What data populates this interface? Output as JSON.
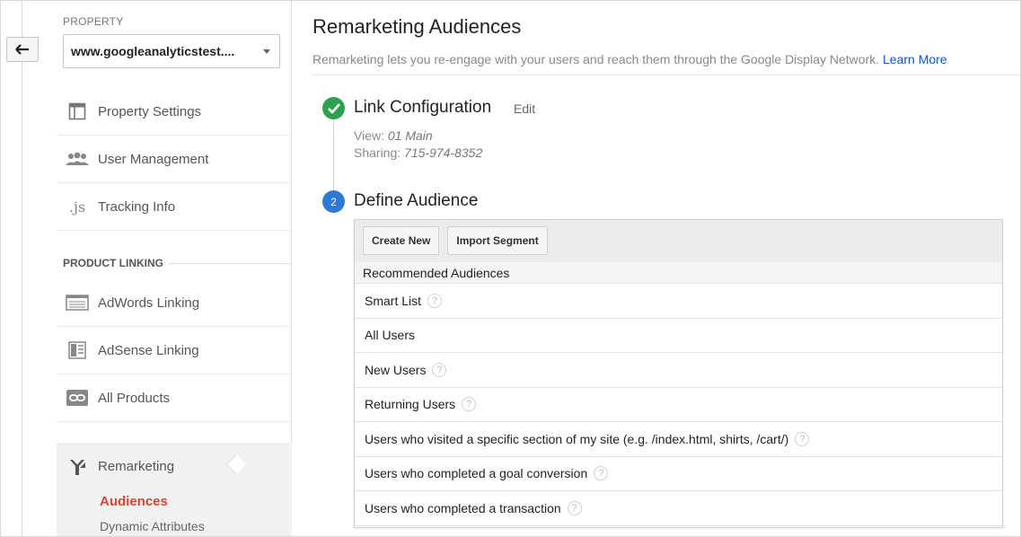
{
  "sidebar": {
    "property_label": "PROPERTY",
    "property_value": "www.googleanalyticstest....",
    "nav_items": [
      {
        "label": "Property Settings",
        "icon": "property-settings-icon"
      },
      {
        "label": "User Management",
        "icon": "users-icon"
      },
      {
        "label": "Tracking Info",
        "icon": "js-icon"
      }
    ],
    "product_linking_label": "PRODUCT LINKING",
    "linking_items": [
      {
        "label": "AdWords Linking",
        "icon": "adwords-icon"
      },
      {
        "label": "AdSense Linking",
        "icon": "adsense-icon"
      },
      {
        "label": "All Products",
        "icon": "link-icon"
      }
    ],
    "remarketing": {
      "label": "Remarketing",
      "icon": "remarketing-icon",
      "sub_items": [
        "Audiences",
        "Dynamic Attributes"
      ],
      "active": "Audiences"
    }
  },
  "main": {
    "title": "Remarketing Audiences",
    "description": "Remarketing lets you re-engage with your users and reach them through the Google Display Network.",
    "learn_more": "Learn More",
    "step1": {
      "title": "Link Configuration",
      "edit": "Edit",
      "view_label": "View:",
      "view_value": "01 Main",
      "sharing_label": "Sharing:",
      "sharing_value": "715-974-8352"
    },
    "step2": {
      "number": "2",
      "title": "Define Audience",
      "buttons": {
        "create_new": "Create New",
        "import_segment": "Import Segment"
      },
      "recommended_header": "Recommended Audiences",
      "audiences": [
        {
          "label": "Smart List",
          "help": true
        },
        {
          "label": "All Users",
          "help": false
        },
        {
          "label": "New Users",
          "help": true
        },
        {
          "label": "Returning Users",
          "help": true
        },
        {
          "label": "Users who visited a specific section of my site (e.g. /index.html, shirts, /cart/)",
          "help": true
        },
        {
          "label": "Users who completed a goal conversion",
          "help": true
        },
        {
          "label": "Users who completed a transaction",
          "help": true
        }
      ]
    }
  },
  "colors": {
    "accent_blue": "#1155cc",
    "active_red": "#d14836",
    "check_green": "#2ea04f",
    "step_blue": "#2d7ad6"
  }
}
